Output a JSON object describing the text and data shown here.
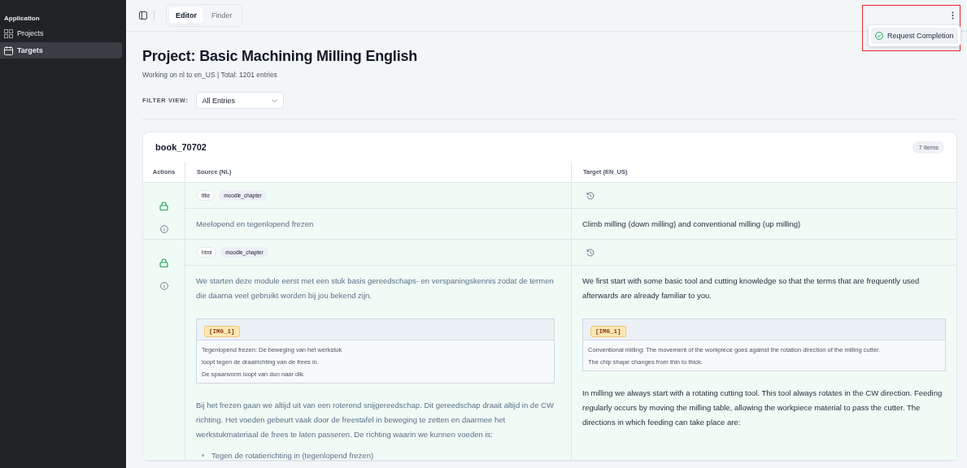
{
  "sidebar": {
    "section": "Application",
    "items": [
      {
        "label": "Projects",
        "kind": "grid",
        "selected": false
      },
      {
        "label": "Targets",
        "kind": "calendar",
        "selected": true
      }
    ]
  },
  "top_bar": {
    "tabs": [
      {
        "label": "Editor",
        "selected": true
      },
      {
        "label": "Finder",
        "selected": false
      }
    ],
    "menu": {
      "items": [
        {
          "label": "Request Completion"
        }
      ]
    }
  },
  "header": {
    "title": "Project: Basic Machining Milling English",
    "subtitle": "Working on nl to en_US | Total: 1201 entries",
    "filter_label": "FILTER VIEW:",
    "filter_value": "All Entries"
  },
  "card": {
    "title": "book_70702",
    "count": "7 Items",
    "columns": [
      "Actions",
      "Source (NL)",
      "Target (EN_US)"
    ],
    "rows": [
      {
        "locked": true,
        "tags": [
          "title",
          "moodle_chapter"
        ],
        "source": [
          {
            "kind": "paragraph",
            "text": "Meelopend en tegenlopend frezen"
          }
        ],
        "target": [
          {
            "kind": "paragraph",
            "text": "Climb milling (down milling) and conventional milling (up milling)"
          }
        ]
      },
      {
        "locked": true,
        "tags": [
          "html",
          "moodle_chapter"
        ],
        "source": [
          {
            "kind": "paragraph",
            "text": "We starten deze module eerst met een stuk basis gereedschaps- en verspaningskennis zodat de termen die daarna veel gebruikt worden bij jou bekend zijn."
          },
          {
            "kind": "image",
            "tag": "[IMG_1]",
            "lines": [
              "Tegenlopend frezen: De beweging van het werkstuk",
              "loopt tegen de draairichting van de frees in.",
              "De spaanvorm loopt van dun naar dik."
            ]
          },
          {
            "kind": "paragraph",
            "text": "Bij het frezen gaan we altijd uit van een roterend snijgereedschap. Dit gereedschap draait altijd in de CW richting. Het voeden gebeurt vaak door de freestafel in beweging te zetten en daarmee het werkstukmateriaal de frees te laten passeren. De richting waarin we kunnen voeden is:"
          },
          {
            "kind": "bullet",
            "text": "Tegen de rotatierichting in (tegenlopend frezen)"
          }
        ],
        "target": [
          {
            "kind": "paragraph",
            "text": "We first start with some basic tool and cutting knowledge so that the terms that are frequently used afterwards are already familiar to you."
          },
          {
            "kind": "image",
            "tag": "[IMG_1]",
            "lines": [
              "Conventional milling: The movement of the workpiece goes against the rotation direction of the milling cutter.",
              "The chip shape changes from thin to thick."
            ]
          },
          {
            "kind": "paragraph",
            "text": "In milling we always start with a rotating cutting tool. This tool always rotates in the CW direction. Feeding regularly occurs by moving the milling table, allowing the workpiece material to pass the cutter. The directions in which feeding can take place are:"
          }
        ]
      }
    ]
  }
}
